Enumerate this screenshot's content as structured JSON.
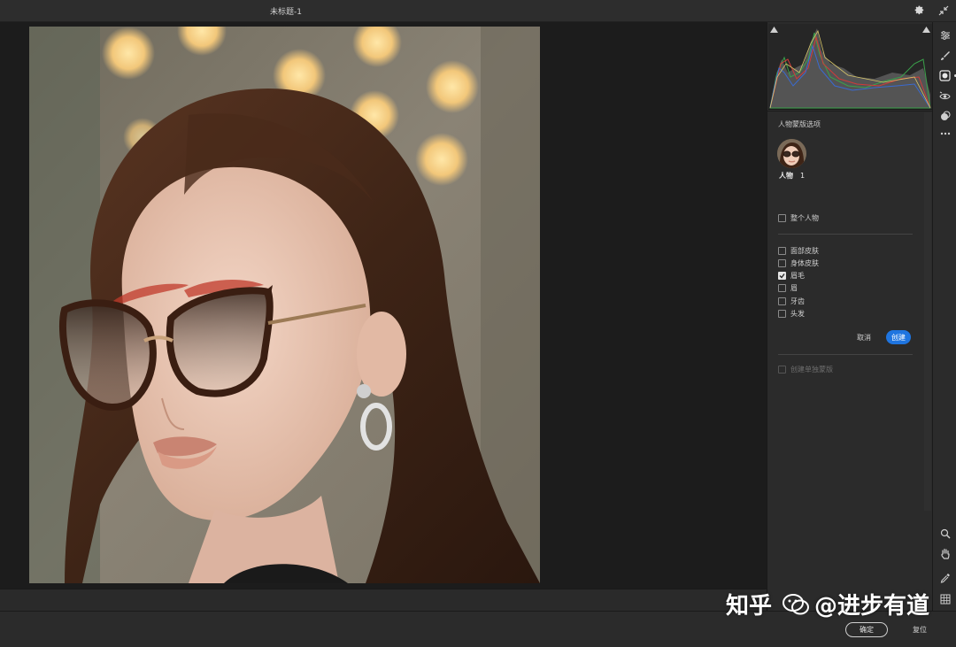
{
  "window": {
    "title": "未标题-1"
  },
  "icons": {
    "settings": "gear-icon",
    "collapse": "collapse-arrows-icon"
  },
  "panel": {
    "section_title": "人物蒙版选项",
    "person": {
      "label": "人物",
      "count": "1"
    },
    "whole_person": {
      "label": "整个人物",
      "checked": false
    },
    "parts": [
      {
        "label": "面部皮肤",
        "checked": false
      },
      {
        "label": "身体皮肤",
        "checked": false
      },
      {
        "label": "眉毛",
        "checked": true
      },
      {
        "label": "眉",
        "checked": false
      },
      {
        "label": "牙齿",
        "checked": false
      },
      {
        "label": "头发",
        "checked": false
      }
    ],
    "cancel_label": "取消",
    "create_label": "创建",
    "separate_mask": {
      "label": "创建单独蒙版",
      "checked": false,
      "enabled": false
    }
  },
  "toolbar": {
    "tools": [
      "sliders-icon",
      "brush-icon",
      "mask-icon",
      "red-eye-icon",
      "presets-icon",
      "more-icon",
      "zoom-icon",
      "hand-icon",
      "eyedropper-icon",
      "grid-icon"
    ],
    "active": "mask-icon"
  },
  "footer": {
    "ok_label": "确定",
    "reset_label": "复位"
  },
  "watermark": {
    "brand": "知乎",
    "author": "@进步有道"
  },
  "colors": {
    "accent": "#1f75e0",
    "panel_bg": "#2b2b2b",
    "canvas_bg": "#1c1c1c"
  }
}
